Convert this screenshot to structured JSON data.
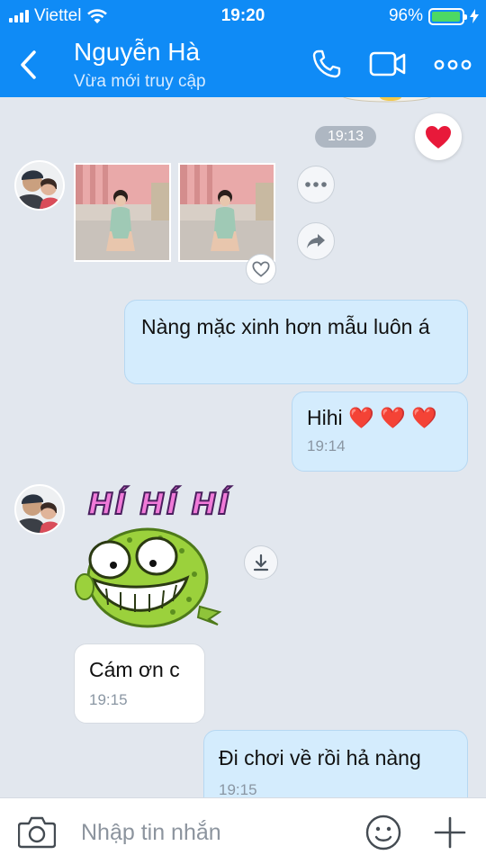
{
  "status_bar": {
    "carrier": "Viettel",
    "time": "19:20",
    "battery": "96%",
    "battery_level": 0.96
  },
  "header": {
    "name": "Nguyễn Hà",
    "status": "Vừa mới truy cập"
  },
  "messages": {
    "time_divider": "19:13",
    "out1_text": "Nàng mặc xinh hơn mẫu luôn á",
    "out2_text": "Hihi ❤️ ❤️ ❤️",
    "out2_time": "19:14",
    "sticker_caption": "HÍ HÍ HÍ",
    "in1_text": "Cám ơn c",
    "in1_time": "19:15",
    "out3_text": "Đi chơi về rồi hả nàng",
    "out3_time": "19:15"
  },
  "composer": {
    "placeholder": "Nhập tin nhắn"
  },
  "colors": {
    "header_bg": "#0f8bf6",
    "outgoing_bubble": "#d4ecfd",
    "incoming_bubble": "#ffffff",
    "heart": "#e8193a"
  }
}
